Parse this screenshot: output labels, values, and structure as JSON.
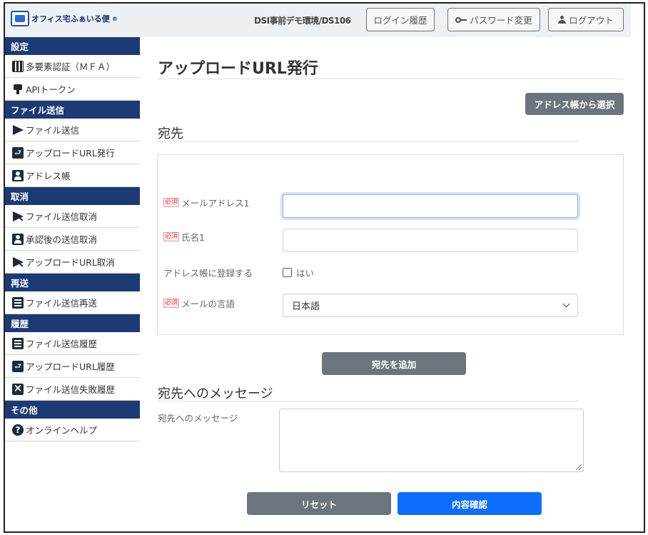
{
  "header": {
    "logo_text": "オフィス宅ふぁいる便",
    "logo_mark": "®",
    "user_id": "DSI事前デモ環境/DS106",
    "login_history_label": "ログイン履歴",
    "password_change_label": "パスワード変更",
    "logout_label": "ログアウト"
  },
  "sidebar": {
    "sections": [
      {
        "title": "設定",
        "items": [
          {
            "label": "多要素認証（ＭＦＡ）",
            "icon": "qr-code-icon"
          },
          {
            "label": "APIトークン",
            "icon": "key-icon"
          }
        ]
      },
      {
        "title": "ファイル送信",
        "items": [
          {
            "label": "ファイル送信",
            "icon": "send-icon"
          },
          {
            "label": "アップロードURL発行",
            "icon": "upload-url-icon"
          },
          {
            "label": "アドレス帳",
            "icon": "address-book-icon"
          }
        ]
      },
      {
        "title": "取消",
        "items": [
          {
            "label": "ファイル送信取消",
            "icon": "send-cancel-icon"
          },
          {
            "label": "承認後の送信取消",
            "icon": "person-icon"
          },
          {
            "label": "アップロードURL取消",
            "icon": "upload-cancel-icon"
          }
        ]
      },
      {
        "title": "再送",
        "items": [
          {
            "label": "ファイル送信再送",
            "icon": "document-icon"
          }
        ]
      },
      {
        "title": "履歴",
        "items": [
          {
            "label": "ファイル送信履歴",
            "icon": "document-icon"
          },
          {
            "label": "アップロードURL履歴",
            "icon": "upload-history-icon"
          },
          {
            "label": "ファイル送信失敗履歴",
            "icon": "x-icon"
          }
        ]
      },
      {
        "title": "その他",
        "items": [
          {
            "label": "オンラインヘルプ",
            "icon": "help-icon"
          }
        ]
      }
    ]
  },
  "main": {
    "page_title": "アップロードURL発行",
    "address_book_button": "アドレス帳から選択",
    "recipient_heading": "宛先",
    "required_badge": "必須",
    "email_label": "メールアドレス1",
    "email_value": "",
    "name_label": "氏名1",
    "name_value": "",
    "register_label": "アドレス帳に登録する",
    "register_checkbox_label": "はい",
    "language_label": "メールの言語",
    "language_value": "日本語",
    "add_recipient_button": "宛先を追加",
    "message_heading": "宛先へのメッセージ",
    "message_label": "宛先へのメッセージ",
    "message_value": "",
    "reset_button": "リセット",
    "confirm_button": "内容確認"
  }
}
